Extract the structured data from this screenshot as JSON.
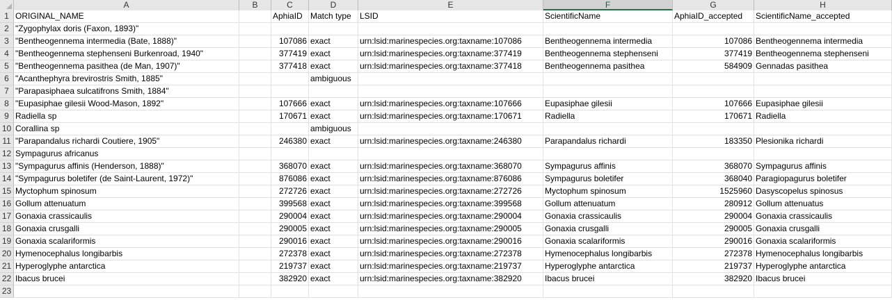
{
  "columns": [
    "A",
    "B",
    "C",
    "D",
    "E",
    "F",
    "G",
    "H"
  ],
  "selected_column": "F",
  "header": {
    "A": "ORIGINAL_NAME",
    "B": "",
    "C": "AphiaID",
    "D": "Match type",
    "E": "LSID",
    "F": "ScientificName",
    "G": "AphiaID_accepted",
    "H": "ScientificName_accepted"
  },
  "rows": [
    {
      "A": "\"Zygophylax  doris (Faxon, 1893)\"",
      "C": "",
      "D": "",
      "E": "",
      "F": "",
      "G": "",
      "H": ""
    },
    {
      "A": "\"Bentheogennema intermedia (Bate, 1888)\"",
      "C": "107086",
      "D": "exact",
      "E": "urn:lsid:marinespecies.org:taxname:107086",
      "F": "Bentheogennema intermedia",
      "G": "107086",
      "H": "Bentheogennema intermedia"
    },
    {
      "A": "\"Bentheogennema stephenseni Burkenroad, 1940\"",
      "C": "377419",
      "D": "exact",
      "E": "urn:lsid:marinespecies.org:taxname:377419",
      "F": "Bentheogennema stephenseni",
      "G": "377419",
      "H": "Bentheogennema stephenseni"
    },
    {
      "A": "\"Bentheogennema pasithea (de Man, 1907)\"",
      "C": "377418",
      "D": "exact",
      "E": "urn:lsid:marinespecies.org:taxname:377418",
      "F": "Bentheogennema pasithea",
      "G": "584909",
      "H": "Gennadas pasithea"
    },
    {
      "A": "\"Acanthephyra brevirostris Smith, 1885\"",
      "C": "",
      "D": "ambiguous",
      "E": "",
      "F": "",
      "G": "",
      "H": ""
    },
    {
      "A": "\"Parapasiphaea sulcatifrons Smith, 1884\"",
      "C": "",
      "D": "",
      "E": "",
      "F": "",
      "G": "",
      "H": ""
    },
    {
      "A": "\"Eupasiphae gilesii Wood-Mason, 1892\"",
      "C": "107666",
      "D": "exact",
      "E": "urn:lsid:marinespecies.org:taxname:107666",
      "F": "Eupasiphae gilesii",
      "G": "107666",
      "H": "Eupasiphae gilesii"
    },
    {
      "A": "Radiella sp",
      "C": "170671",
      "D": "exact",
      "E": "urn:lsid:marinespecies.org:taxname:170671",
      "F": "Radiella",
      "G": "170671",
      "H": "Radiella"
    },
    {
      "A": "Corallina sp",
      "C": "",
      "D": "ambiguous",
      "E": "",
      "F": "",
      "G": "",
      "H": ""
    },
    {
      "A": "\"Parapandalus richardi Coutiere, 1905\"",
      "C": "246380",
      "D": "exact",
      "E": "urn:lsid:marinespecies.org:taxname:246380",
      "F": "Parapandalus richardi",
      "G": "183350",
      "H": "Plesionika richardi"
    },
    {
      "A": "Sympagurus africanus",
      "C": "",
      "D": "",
      "E": "",
      "F": "",
      "G": "",
      "H": ""
    },
    {
      "A": "\"Sympagurus affinis (Henderson, 1888)\"",
      "C": "368070",
      "D": "exact",
      "E": "urn:lsid:marinespecies.org:taxname:368070",
      "F": "Sympagurus affinis",
      "G": "368070",
      "H": "Sympagurus affinis"
    },
    {
      "A": "\"Sympagurus boletifer (de Saint-Laurent, 1972)\"",
      "C": "876086",
      "D": "exact",
      "E": "urn:lsid:marinespecies.org:taxname:876086",
      "F": "Sympagurus boletifer",
      "G": "368040",
      "H": "Paragiopagurus boletifer"
    },
    {
      "A": "Myctophum spinosum",
      "C": "272726",
      "D": "exact",
      "E": "urn:lsid:marinespecies.org:taxname:272726",
      "F": "Myctophum spinosum",
      "G": "1525960",
      "H": "Dasyscopelus spinosus"
    },
    {
      "A": "Gollum attenuatum",
      "C": "399568",
      "D": "exact",
      "E": "urn:lsid:marinespecies.org:taxname:399568",
      "F": "Gollum attenuatum",
      "G": "280912",
      "H": "Gollum attenuatus"
    },
    {
      "A": "Gonaxia crassicaulis",
      "C": "290004",
      "D": "exact",
      "E": "urn:lsid:marinespecies.org:taxname:290004",
      "F": "Gonaxia crassicaulis",
      "G": "290004",
      "H": "Gonaxia crassicaulis"
    },
    {
      "A": "Gonaxia crusgalli",
      "C": "290005",
      "D": "exact",
      "E": "urn:lsid:marinespecies.org:taxname:290005",
      "F": "Gonaxia crusgalli",
      "G": "290005",
      "H": "Gonaxia crusgalli"
    },
    {
      "A": "Gonaxia scalariformis",
      "C": "290016",
      "D": "exact",
      "E": "urn:lsid:marinespecies.org:taxname:290016",
      "F": "Gonaxia scalariformis",
      "G": "290016",
      "H": "Gonaxia scalariformis"
    },
    {
      "A": "Hymenocephalus longibarbis",
      "C": "272378",
      "D": "exact",
      "E": "urn:lsid:marinespecies.org:taxname:272378",
      "F": "Hymenocephalus longibarbis",
      "G": "272378",
      "H": "Hymenocephalus longibarbis"
    },
    {
      "A": "Hyperoglyphe antarctica",
      "C": "219737",
      "D": "exact",
      "E": "urn:lsid:marinespecies.org:taxname:219737",
      "F": "Hyperoglyphe antarctica",
      "G": "219737",
      "H": "Hyperoglyphe antarctica"
    },
    {
      "A": "Ibacus brucei",
      "C": "382920",
      "D": "exact",
      "E": "urn:lsid:marinespecies.org:taxname:382920",
      "F": "Ibacus brucei",
      "G": "382920",
      "H": "Ibacus brucei"
    },
    {
      "A": "",
      "C": "",
      "D": "",
      "E": "",
      "F": "",
      "G": "",
      "H": ""
    }
  ],
  "row_numbers": [
    "1",
    "2",
    "3",
    "4",
    "5",
    "6",
    "7",
    "8",
    "9",
    "10",
    "11",
    "12",
    "13",
    "14",
    "15",
    "16",
    "17",
    "18",
    "19",
    "20",
    "21",
    "22",
    "23"
  ]
}
